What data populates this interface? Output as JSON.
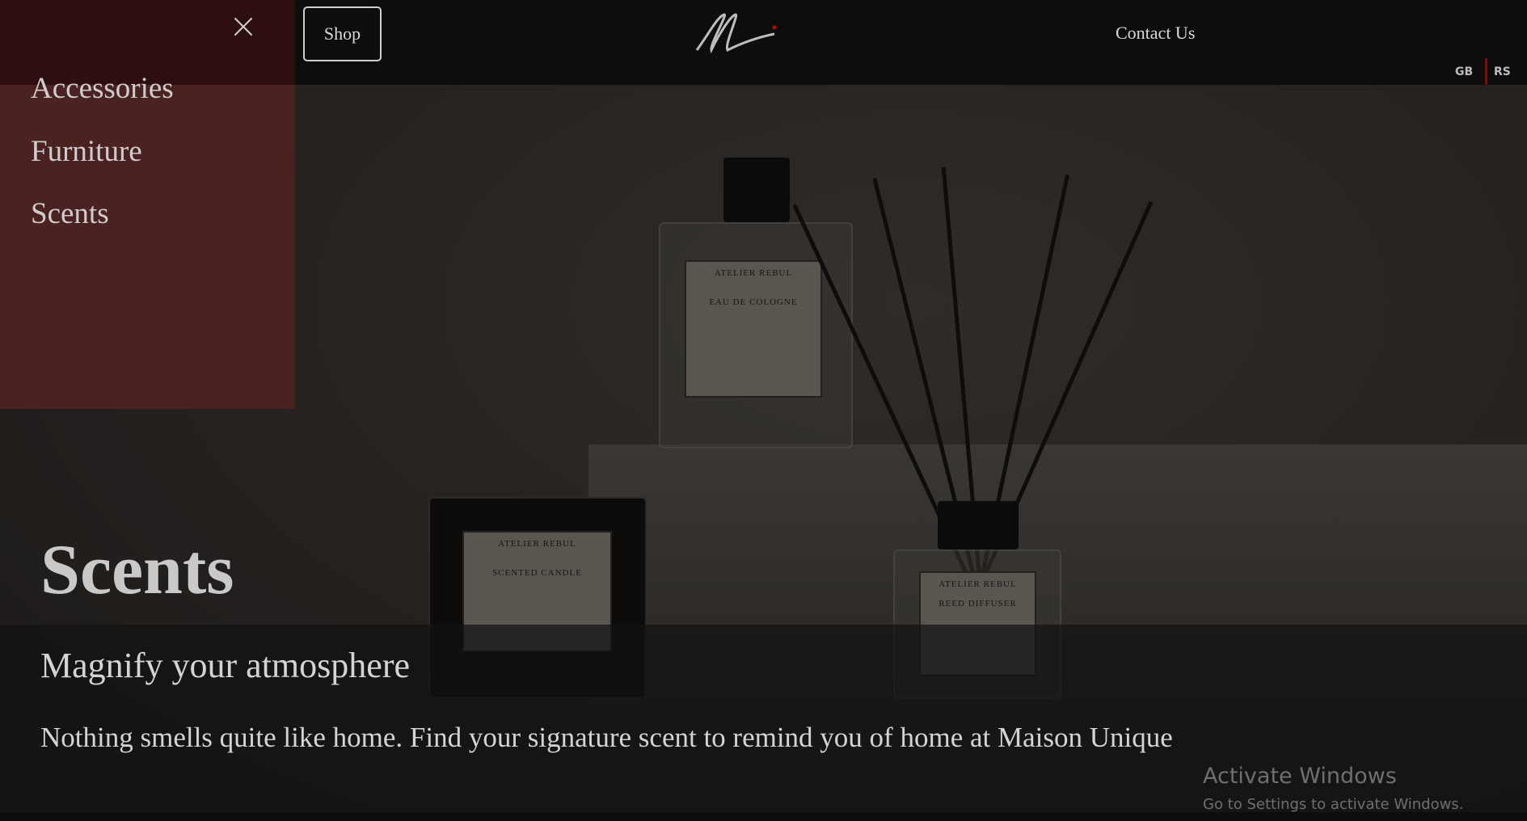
{
  "header": {
    "shop_label": "Shop",
    "contact_label": "Contact Us",
    "languages": [
      "GB",
      "RS"
    ],
    "logo_text": "M"
  },
  "sidebar": {
    "items": [
      {
        "label": "Accessories"
      },
      {
        "label": "Furniture"
      },
      {
        "label": "Scents"
      }
    ]
  },
  "hero": {
    "title": "Scents",
    "subtitle": "Magnify your atmosphere",
    "description": "Nothing smells quite like home. Find your signature scent to remind you of home at Maison Unique",
    "product_brand": "ATELIER REBUL",
    "product_labels": [
      "EAU DE COLOGNE",
      "SCENTED CANDLE",
      "REED DIFFUSER"
    ]
  },
  "watermark": {
    "line1": "Activate Windows",
    "line2": "Go to Settings to activate Windows."
  },
  "colors": {
    "sidebar": "#4a2222",
    "accent": "#7a0d0d",
    "header": "#0d0d0d"
  }
}
